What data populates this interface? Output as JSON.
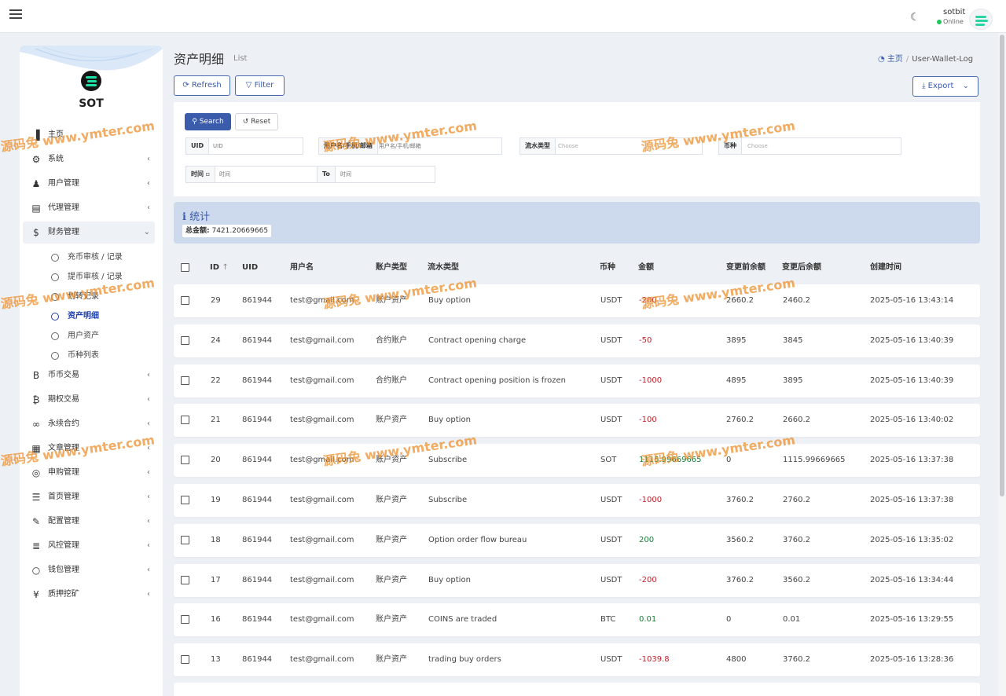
{
  "topbar": {
    "user_name": "sotbit",
    "user_status": "Online"
  },
  "sidebar": {
    "logo_text": "SOT",
    "items": [
      {
        "label": "主页",
        "icon": "bar-chart-icon",
        "glyph": "▐",
        "caret": ""
      },
      {
        "label": "系统",
        "icon": "gear-icon",
        "glyph": "⚙",
        "caret": "‹"
      },
      {
        "label": "用户管理",
        "icon": "user-icon",
        "glyph": "♟",
        "caret": "‹"
      },
      {
        "label": "代理管理",
        "icon": "id-card-icon",
        "glyph": "▤",
        "caret": "‹"
      },
      {
        "label": "财务管理",
        "icon": "dollar-icon",
        "glyph": "$",
        "caret": "⌄"
      },
      {
        "label": "币币交易",
        "icon": "b-icon",
        "glyph": "B",
        "caret": "‹"
      },
      {
        "label": "期权交易",
        "icon": "bitcoin-icon",
        "glyph": "₿",
        "caret": "‹"
      },
      {
        "label": "永续合约",
        "icon": "link-icon",
        "glyph": "∞",
        "caret": "‹"
      },
      {
        "label": "文章管理",
        "icon": "newspaper-icon",
        "glyph": "▦",
        "caret": "‹"
      },
      {
        "label": "申购管理",
        "icon": "lifebuoy-icon",
        "glyph": "◎",
        "caret": "‹"
      },
      {
        "label": "首页管理",
        "icon": "list-icon",
        "glyph": "☰",
        "caret": "‹"
      },
      {
        "label": "配置管理",
        "icon": "wrench-icon",
        "glyph": "✎",
        "caret": "‹"
      },
      {
        "label": "风控管理",
        "icon": "list-indent-icon",
        "glyph": "≣",
        "caret": "‹"
      },
      {
        "label": "钱包管理",
        "icon": "circle-icon",
        "glyph": "○",
        "caret": "‹"
      },
      {
        "label": "质押挖矿",
        "icon": "yen-icon",
        "glyph": "¥",
        "caret": "‹"
      }
    ],
    "sub_items": [
      {
        "label": "充币审核 / 记录"
      },
      {
        "label": "提币审核 / 记录"
      },
      {
        "label": "划转记录"
      },
      {
        "label": "资产明细"
      },
      {
        "label": "用户资产"
      },
      {
        "label": "币种列表"
      }
    ]
  },
  "header": {
    "title": "资产明细",
    "subtitle": "List",
    "breadcrumb_home": "主页",
    "breadcrumb_sep": "/",
    "breadcrumb_current": "User-Wallet-Log"
  },
  "toolbar": {
    "refresh_label": "Refresh",
    "filter_label": "Filter",
    "export_label": "Export"
  },
  "filter": {
    "search_label": "Search",
    "reset_label": "Reset",
    "uid_label": "UID",
    "uid_placeholder": "UID",
    "username_label": "用户名/手机/邮箱",
    "username_placeholder": "用户名/手机/邮箱",
    "flow_type_label": "流水类型",
    "flow_type_placeholder": "Choose",
    "coin_label": "币种",
    "coin_placeholder": "Choose",
    "time_label": "时间",
    "time_placeholder": "时间",
    "to_label": "To",
    "to_placeholder": "时间"
  },
  "stats": {
    "title": "统计",
    "total_label": "总金额:",
    "total_value": "7421.20669665"
  },
  "table": {
    "columns": [
      "ID",
      "UID",
      "用户名",
      "账户类型",
      "流水类型",
      "币种",
      "金额",
      "变更前余额",
      "变更后余额",
      "创建时间"
    ],
    "rows": [
      {
        "id": "29",
        "uid": "861944",
        "username": "test@gmail.com",
        "account_type": "账户资产",
        "flow_type": "Buy option",
        "coin": "USDT",
        "amount": "-200",
        "before": "2660.2",
        "after": "2460.2",
        "created": "2025-05-16 13:43:14"
      },
      {
        "id": "24",
        "uid": "861944",
        "username": "test@gmail.com",
        "account_type": "合约账户",
        "flow_type": "Contract opening charge",
        "coin": "USDT",
        "amount": "-50",
        "before": "3895",
        "after": "3845",
        "created": "2025-05-16 13:40:39"
      },
      {
        "id": "22",
        "uid": "861944",
        "username": "test@gmail.com",
        "account_type": "合约账户",
        "flow_type": "Contract opening position is frozen",
        "coin": "USDT",
        "amount": "-1000",
        "before": "4895",
        "after": "3895",
        "created": "2025-05-16 13:40:39"
      },
      {
        "id": "21",
        "uid": "861944",
        "username": "test@gmail.com",
        "account_type": "账户资产",
        "flow_type": "Buy option",
        "coin": "USDT",
        "amount": "-100",
        "before": "2760.2",
        "after": "2660.2",
        "created": "2025-05-16 13:40:02"
      },
      {
        "id": "20",
        "uid": "861944",
        "username": "test@gmail.com",
        "account_type": "账户资产",
        "flow_type": "Subscribe",
        "coin": "SOT",
        "amount": "1115.99669665",
        "before": "0",
        "after": "1115.99669665",
        "created": "2025-05-16 13:37:38"
      },
      {
        "id": "19",
        "uid": "861944",
        "username": "test@gmail.com",
        "account_type": "账户资产",
        "flow_type": "Subscribe",
        "coin": "USDT",
        "amount": "-1000",
        "before": "3760.2",
        "after": "2760.2",
        "created": "2025-05-16 13:37:38"
      },
      {
        "id": "18",
        "uid": "861944",
        "username": "test@gmail.com",
        "account_type": "账户资产",
        "flow_type": "Option order flow bureau",
        "coin": "USDT",
        "amount": "200",
        "before": "3560.2",
        "after": "3760.2",
        "created": "2025-05-16 13:35:02"
      },
      {
        "id": "17",
        "uid": "861944",
        "username": "test@gmail.com",
        "account_type": "账户资产",
        "flow_type": "Buy option",
        "coin": "USDT",
        "amount": "-200",
        "before": "3760.2",
        "after": "3560.2",
        "created": "2025-05-16 13:34:44"
      },
      {
        "id": "16",
        "uid": "861944",
        "username": "test@gmail.com",
        "account_type": "账户资产",
        "flow_type": "COINS are traded",
        "coin": "BTC",
        "amount": "0.01",
        "before": "0",
        "after": "0.01",
        "created": "2025-05-16 13:29:55"
      },
      {
        "id": "13",
        "uid": "861944",
        "username": "test@gmail.com",
        "account_type": "账户资产",
        "flow_type": "trading buy orders",
        "coin": "USDT",
        "amount": "-1039.8",
        "before": "4800",
        "after": "3760.2",
        "created": "2025-05-16 13:28:36"
      }
    ]
  },
  "watermark": {
    "text": "源码兔 www.ymter.com"
  },
  "colors": {
    "accent": "#3b5bab",
    "positive": "#1a7f37",
    "negative": "#c0222b",
    "stats_bg": "#cdd9ed"
  }
}
